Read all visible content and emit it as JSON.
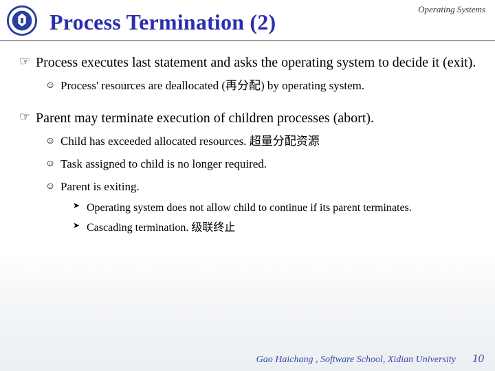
{
  "header": {
    "label": "Operating Systems"
  },
  "title": "Process Termination (2)",
  "bullets": [
    {
      "text": "Process executes last statement and asks the operating system to decide it (exit).",
      "children": [
        {
          "text": "Process' resources are deallocated (再分配) by operating system."
        }
      ]
    },
    {
      "text": "Parent may terminate execution of children processes (abort).",
      "children": [
        {
          "text": "Child has exceeded allocated resources. 超量分配资源"
        },
        {
          "text": "Task assigned to child is no longer required."
        },
        {
          "text": "Parent is exiting.",
          "children": [
            {
              "text": "Operating system does not allow child to continue if its parent terminates."
            },
            {
              "text": "Cascading termination. 级联终止"
            }
          ]
        }
      ]
    }
  ],
  "footer": {
    "attribution": "Gao Haichang , Software School, Xidian University",
    "page": "10"
  },
  "glyphs": {
    "lvl1": "☞",
    "lvl2": "☺",
    "lvl3": "➤"
  },
  "colors": {
    "title": "#2d2db0",
    "footer": "#3a4aa8"
  }
}
